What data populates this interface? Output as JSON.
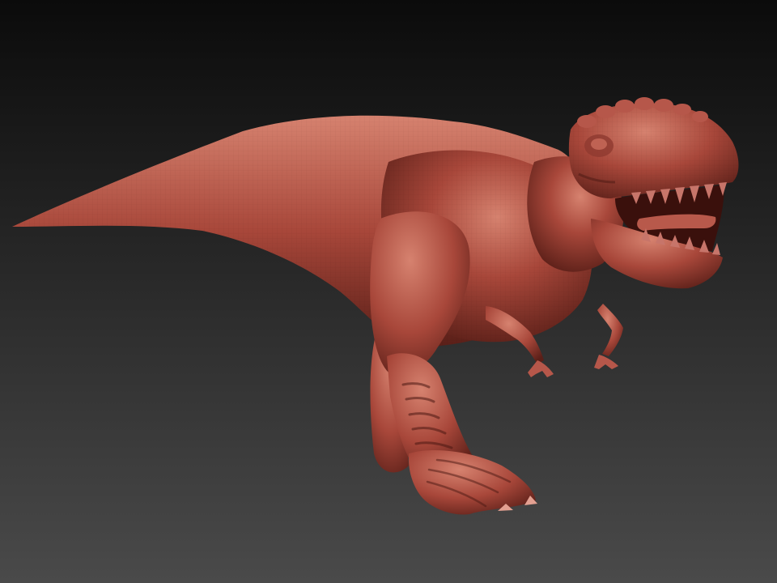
{
  "scene": {
    "subject": "dinosaur-sculpt",
    "colors": {
      "background_top": "#0b0b0b",
      "background_bottom": "#4a4a4a",
      "clay_base": "#a8473a",
      "clay_light": "#d6826f",
      "clay_dark": "#5a1f18",
      "tooth": "#c7756a"
    }
  }
}
